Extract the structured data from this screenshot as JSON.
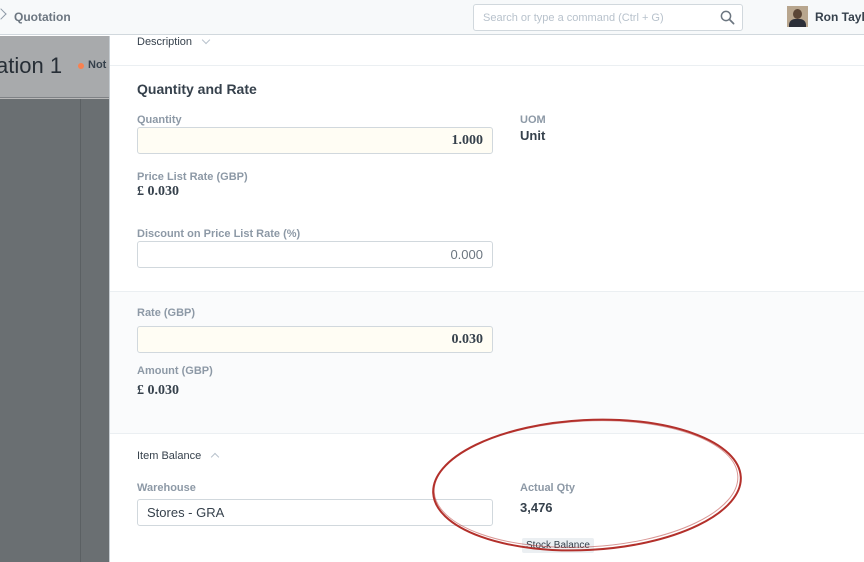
{
  "navbar": {
    "breadcrumb": "Quotation",
    "search_placeholder": "Search or type a command (Ctrl + G)",
    "user_name": "Ron Taylor"
  },
  "page": {
    "title": "ation 1",
    "status": "Not"
  },
  "description": {
    "label": "Description"
  },
  "quantity_and_rate": {
    "heading": "Quantity and Rate",
    "quantity_label": "Quantity",
    "quantity_value": "1.000",
    "uom_label": "UOM",
    "uom_value": "Unit",
    "price_list_rate_label": "Price List Rate (GBP)",
    "price_list_rate_value": "£ 0.030",
    "discount_label": "Discount on Price List Rate (%)",
    "discount_value": "0.000"
  },
  "rate_section": {
    "rate_label": "Rate (GBP)",
    "rate_value": "0.030",
    "amount_label": "Amount (GBP)",
    "amount_value": "£ 0.030"
  },
  "item_balance": {
    "label": "Item Balance",
    "warehouse_label": "Warehouse",
    "warehouse_value": "Stores - GRA",
    "actual_qty_label": "Actual Qty",
    "actual_qty_value": "3,476",
    "stock_balance_label": "Stock Balance"
  },
  "colors": {
    "annotation_ellipse": "#b3302b",
    "mandatory_field_bg": "#fffdf4",
    "status_indicator": "#f8814f"
  }
}
